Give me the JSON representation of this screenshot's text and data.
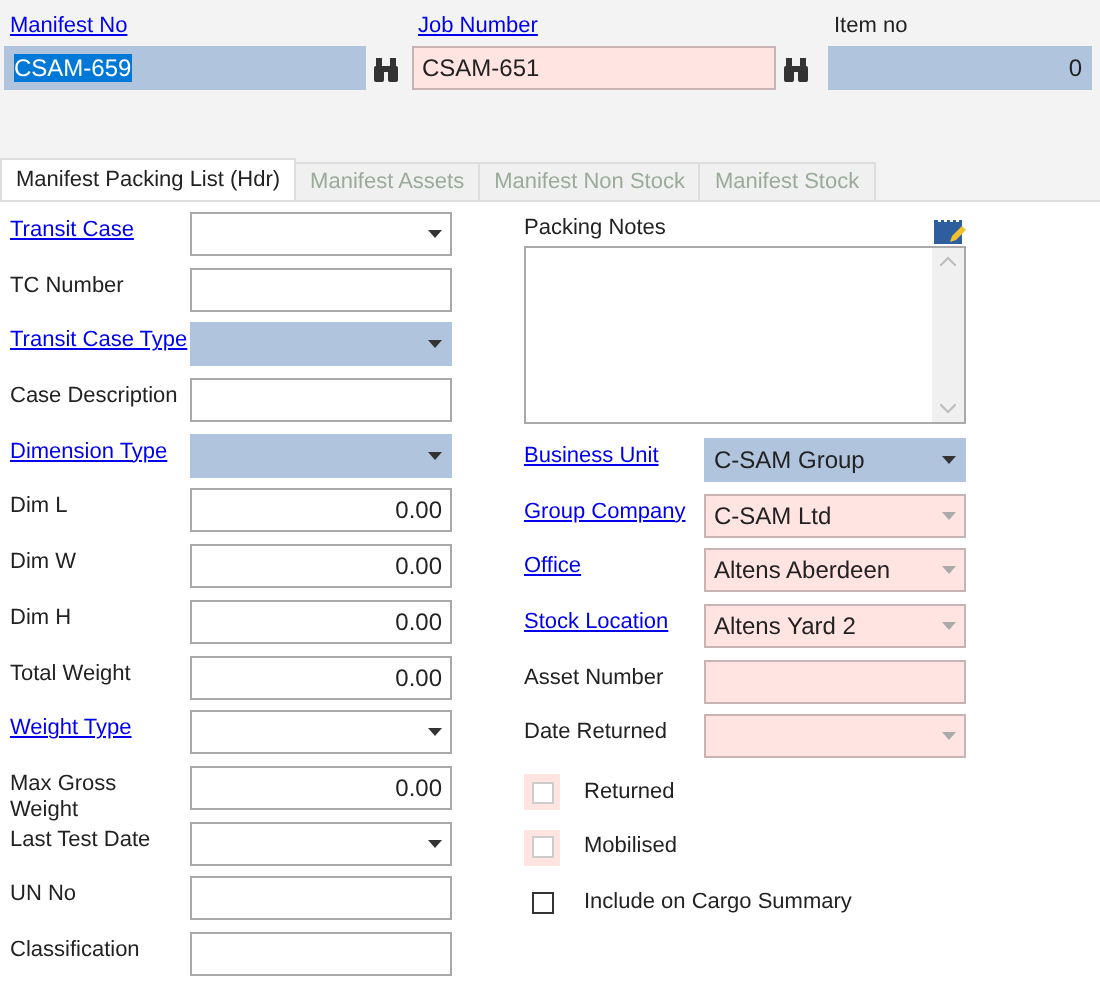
{
  "header": {
    "fields": [
      {
        "label": "Manifest No",
        "link": true,
        "kind": "text",
        "value": "CSAM-659",
        "color": "#b0c4de",
        "highlighted": true,
        "lookup": true
      },
      {
        "label": "Job Number",
        "link": true,
        "kind": "text",
        "value": "CSAM-651",
        "color": "#ffe4e1",
        "highlighted": false,
        "lookup": true
      },
      {
        "label": "Item no",
        "link": false,
        "kind": "number",
        "value": "0",
        "color": "#b0c4de",
        "highlighted": false,
        "lookup": false
      }
    ]
  },
  "tabs": [
    {
      "label": "Manifest Packing List (Hdr)",
      "selected": true
    },
    {
      "label": "Manifest Assets",
      "selected": false
    },
    {
      "label": "Manifest Non Stock",
      "selected": false
    },
    {
      "label": "Manifest Stock",
      "selected": false
    }
  ],
  "left_fields": [
    {
      "label": "Transit Case",
      "link": true,
      "kind": "dropdown",
      "color": "#ffffff"
    },
    {
      "label": "TC Number",
      "link": false,
      "kind": "text",
      "color": "#ffffff"
    },
    {
      "label": "Transit Case Type",
      "link": true,
      "kind": "dropdown",
      "color": "#b0c4de"
    },
    {
      "label": "Case Description",
      "link": false,
      "kind": "text",
      "color": "#ffffff"
    },
    {
      "label": "Dimension Type",
      "link": true,
      "kind": "dropdown",
      "color": "#b0c4de"
    },
    {
      "label": "Dim L",
      "link": false,
      "kind": "number",
      "value": "0.00",
      "color": "#ffffff"
    },
    {
      "label": "Dim W",
      "link": false,
      "kind": "number",
      "value": "0.00",
      "color": "#ffffff"
    },
    {
      "label": "Dim H",
      "link": false,
      "kind": "number",
      "value": "0.00",
      "color": "#ffffff"
    },
    {
      "label": "Total Weight",
      "link": false,
      "kind": "number",
      "value": "0.00",
      "color": "#ffffff"
    },
    {
      "label": "Weight Type",
      "link": true,
      "kind": "dropdown",
      "color": "#ffffff"
    },
    {
      "label": "Max Gross Weight",
      "link": false,
      "kind": "number",
      "value": "0.00",
      "color": "#ffffff"
    },
    {
      "label": "Last Test Date",
      "link": false,
      "kind": "dropdown",
      "color": "#ffffff"
    },
    {
      "label": "UN No",
      "link": false,
      "kind": "text",
      "color": "#ffffff"
    },
    {
      "label": "Classification",
      "link": false,
      "kind": "text",
      "color": "#ffffff"
    }
  ],
  "packing_notes": {
    "label": "Packing Notes"
  },
  "right_fields": [
    {
      "label": "Business Unit",
      "link": true,
      "kind": "dropdown",
      "value": "C-SAM Group",
      "color": "#b0c4de"
    },
    {
      "label": "Group Company",
      "link": true,
      "kind": "dropdown",
      "value": "C-SAM Ltd",
      "color": "#ffe4e1"
    },
    {
      "label": "Office",
      "link": true,
      "kind": "dropdown",
      "value": "Altens Aberdeen",
      "color": "#ffe4e1"
    },
    {
      "label": "Stock Location",
      "link": true,
      "kind": "dropdown",
      "value": "Altens Yard 2",
      "color": "#ffe4e1"
    },
    {
      "label": "Asset Number",
      "link": false,
      "kind": "text",
      "color": "#ffe4e1"
    },
    {
      "label": "Date Returned",
      "link": false,
      "kind": "dropdown",
      "color": "#ffe4e1"
    }
  ],
  "checkboxes": [
    {
      "label": "Returned",
      "checked": false,
      "required": true
    },
    {
      "label": "Mobilised",
      "checked": false,
      "required": true
    },
    {
      "label": "Include on Cargo Summary",
      "checked": false,
      "required": false
    }
  ]
}
